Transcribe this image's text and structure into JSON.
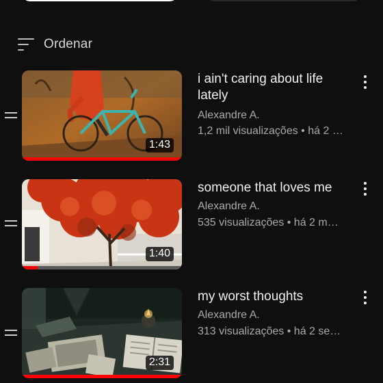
{
  "sort": {
    "label": "Ordenar",
    "icon": "sort-icon"
  },
  "colors": {
    "background": "#0f0f0f",
    "progress": "#ff0000",
    "text_primary": "#f1f1f1",
    "text_secondary": "#aaaaaa"
  },
  "videos": [
    {
      "title": "i ain't caring about life lately",
      "channel": "Alexandre A.",
      "meta": "1,2 mil visualizações • há 2 …",
      "duration": "1:43",
      "watched_fraction": 1.0
    },
    {
      "title": "someone that loves me",
      "channel": "Alexandre A.",
      "meta": "535 visualizações • há 2 m…",
      "duration": "1:40",
      "watched_fraction": 0.1
    },
    {
      "title": "my worst thoughts",
      "channel": "Alexandre A.",
      "meta": "313 visualizações • há 2 se…",
      "duration": "2:31",
      "watched_fraction": 1.0
    }
  ]
}
